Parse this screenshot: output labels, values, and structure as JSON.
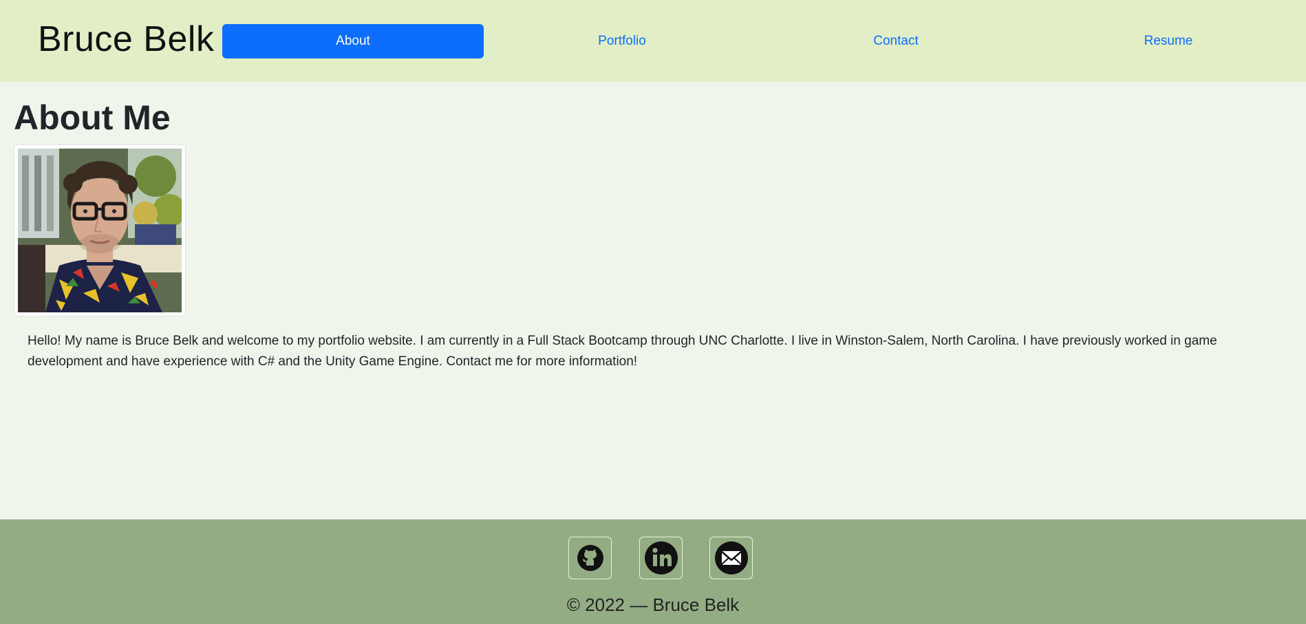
{
  "header": {
    "brand": "Bruce Belk",
    "nav": [
      {
        "label": "About",
        "active": true
      },
      {
        "label": "Portfolio",
        "active": false
      },
      {
        "label": "Contact",
        "active": false
      },
      {
        "label": "Resume",
        "active": false
      }
    ]
  },
  "main": {
    "title": "About Me",
    "photo_alt": "profile-photo",
    "bio": "Hello! My name is Bruce Belk and welcome to my portfolio website. I am currently in a Full Stack Bootcamp through UNC Charlotte. I live in Winston-Salem, North Carolina. I have previously worked in game development and have experience with C# and the Unity Game Engine. Contact me for more information!"
  },
  "footer": {
    "social": [
      {
        "icon": "github-icon"
      },
      {
        "icon": "linkedin-icon"
      },
      {
        "icon": "email-icon"
      }
    ],
    "copyright": "© 2022 — Bruce Belk"
  },
  "colors": {
    "header_bg": "#e2eec6",
    "page_bg": "#f0f5ec",
    "footer_bg": "#93ac84",
    "accent": "#0d6efd"
  }
}
